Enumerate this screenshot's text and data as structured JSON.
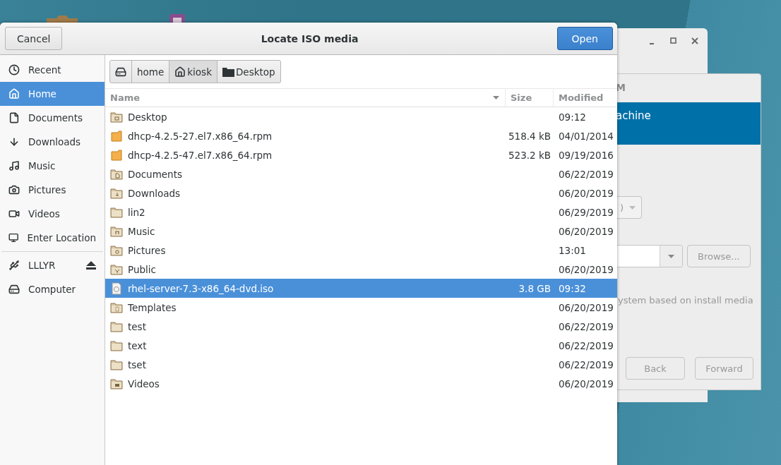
{
  "wizard": {
    "title": "M",
    "header": "achine",
    "combo_value": ")",
    "browse_button": "Browse...",
    "note": "ystem based on install media",
    "buttons": [
      "Back",
      "Forward"
    ]
  },
  "dialog": {
    "cancel": "Cancel",
    "title": "Locate ISO media",
    "open": "Open"
  },
  "sidebar": {
    "sections": [
      [
        {
          "kind": "recent",
          "label": "Recent",
          "selected": false
        },
        {
          "kind": "home",
          "label": "Home",
          "selected": true
        },
        {
          "kind": "documents",
          "label": "Documents",
          "selected": false
        },
        {
          "kind": "downloads",
          "label": "Downloads",
          "selected": false
        },
        {
          "kind": "music",
          "label": "Music",
          "selected": false
        },
        {
          "kind": "pictures",
          "label": "Pictures",
          "selected": false
        },
        {
          "kind": "videos",
          "label": "Videos",
          "selected": false
        },
        {
          "kind": "location",
          "label": "Enter Location",
          "selected": false
        }
      ],
      [
        {
          "kind": "usb",
          "label": "LLLYR",
          "selected": false,
          "ejectable": true
        },
        {
          "kind": "computer",
          "label": "Computer",
          "selected": false,
          "ejectable": false
        }
      ]
    ]
  },
  "path_bar": [
    {
      "kind": "computer",
      "selected": false
    },
    {
      "kind": "plain",
      "label": "home",
      "selected": false
    },
    {
      "kind": "home",
      "label": "kiosk",
      "selected": true
    },
    {
      "kind": "folder",
      "label": "Desktop",
      "selected": false
    }
  ],
  "columns": [
    {
      "label": "Name",
      "sorted": true
    },
    {
      "label": "Size",
      "sorted": false
    },
    {
      "label": "Modified",
      "sorted": false
    }
  ],
  "rows": [
    {
      "kind": "desktop",
      "name": "Desktop",
      "modified": "09:12",
      "selected": false
    },
    {
      "kind": "package",
      "name": "dhcp-4.2.5-27.el7.x86_64.rpm",
      "size": "518.4 kB",
      "modified": "04/01/2014",
      "selected": false
    },
    {
      "kind": "package",
      "name": "dhcp-4.2.5-47.el7.x86_64.rpm",
      "size": "523.2 kB",
      "modified": "09/19/2016",
      "selected": false
    },
    {
      "kind": "documents",
      "name": "Documents",
      "modified": "06/22/2019",
      "selected": false
    },
    {
      "kind": "downloads",
      "name": "Downloads",
      "modified": "06/20/2019",
      "selected": false
    },
    {
      "kind": "folder",
      "name": "lin2",
      "modified": "06/29/2019",
      "selected": false
    },
    {
      "kind": "music",
      "name": "Music",
      "modified": "06/20/2019",
      "selected": false
    },
    {
      "kind": "pictures",
      "name": "Pictures",
      "modified": "13:01",
      "selected": false
    },
    {
      "kind": "public",
      "name": "Public",
      "modified": "06/20/2019",
      "selected": false
    },
    {
      "kind": "disc",
      "name": "rhel-server-7.3-x86_64-dvd.iso",
      "size": "3.8 GB",
      "modified": "09:32",
      "selected": true
    },
    {
      "kind": "templates",
      "name": "Templates",
      "modified": "06/20/2019",
      "selected": false
    },
    {
      "kind": "folder",
      "name": "test",
      "modified": "06/22/2019",
      "selected": false
    },
    {
      "kind": "folder",
      "name": "text",
      "modified": "06/22/2019",
      "selected": false
    },
    {
      "kind": "folder",
      "name": "tset",
      "modified": "06/22/2019",
      "selected": false
    },
    {
      "kind": "videos",
      "name": "Videos",
      "modified": "06/20/2019",
      "selected": false
    }
  ]
}
